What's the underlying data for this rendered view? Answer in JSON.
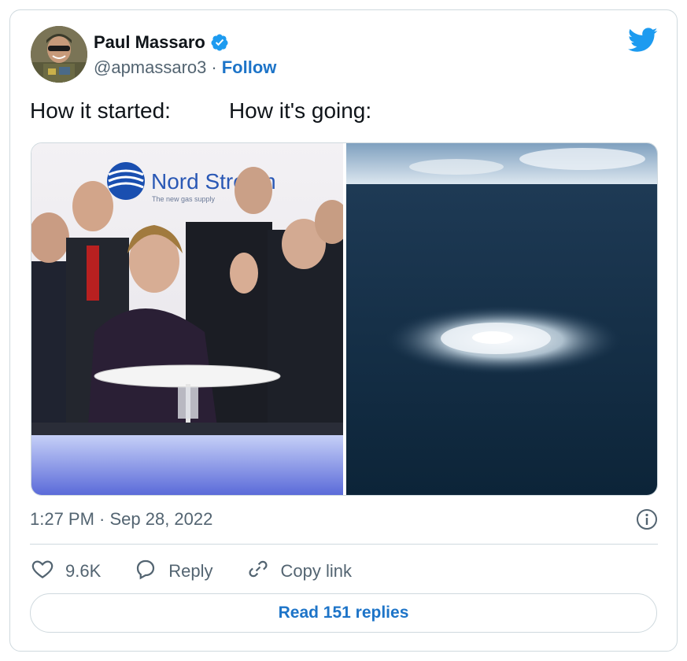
{
  "user": {
    "display_name": "Paul Massaro",
    "handle": "@apmassaro3",
    "separator": "·",
    "follow_label": "Follow"
  },
  "tweet": {
    "text_left": "How it started:",
    "text_right": "How it's going:",
    "timestamp": "1:27 PM · Sep 28, 2022"
  },
  "media": {
    "left_photo_caption": "Nord Stream",
    "left_photo_subcaption": "The new gas supply"
  },
  "actions": {
    "like_count": "9.6K",
    "reply_label": "Reply",
    "copy_link_label": "Copy link"
  },
  "read_replies_label": "Read 151 replies",
  "colors": {
    "accent": "#1d74c8",
    "twitter_blue": "#1d9bf0",
    "muted_text": "#536471",
    "border": "#cfd9de"
  },
  "icons": {
    "verified": "verified-badge-icon",
    "logo": "twitter-bird-icon",
    "info": "info-icon",
    "like": "heart-icon",
    "reply": "speech-bubble-icon",
    "copy": "link-icon"
  }
}
